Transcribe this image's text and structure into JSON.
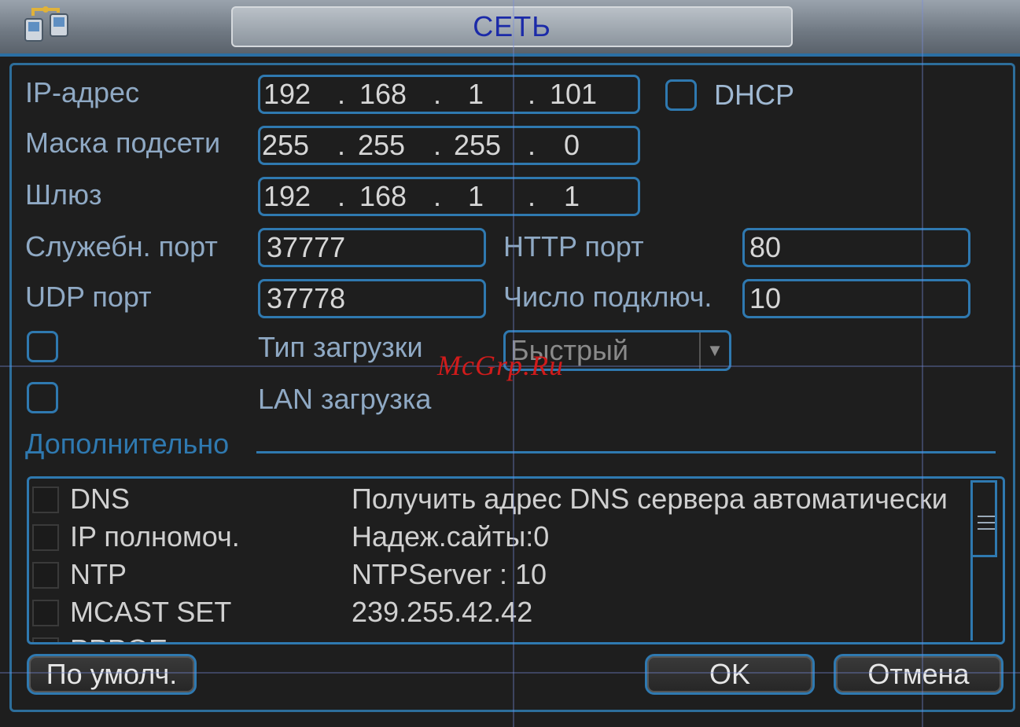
{
  "window": {
    "title": "СЕТЬ"
  },
  "fields": {
    "ip": {
      "label": "IP-адрес",
      "octets": [
        "192",
        "168",
        "1",
        "101"
      ]
    },
    "mask": {
      "label": "Маска подсети",
      "octets": [
        "255",
        "255",
        "255",
        "0"
      ]
    },
    "gateway": {
      "label": "Шлюз",
      "octets": [
        "192",
        "168",
        "1",
        "1"
      ]
    },
    "dhcp": {
      "label": "DHCP",
      "checked": false
    },
    "service_port": {
      "label": "Служебн. порт",
      "value": "37777"
    },
    "http_port": {
      "label": "HTTP порт",
      "value": "80"
    },
    "udp_port": {
      "label": "UDP порт",
      "value": "37778"
    },
    "max_conn": {
      "label": "Число подключ.",
      "value": "10"
    },
    "download_type": {
      "label": "Тип загрузки",
      "value": "Быстрый",
      "enabled": false
    },
    "lan_download": {
      "label": "LAN загрузка",
      "enabled": false
    }
  },
  "advanced": {
    "label": "Дополнительно",
    "rows": [
      {
        "name": "DNS",
        "value": "Получить адрес DNS сервера автоматически"
      },
      {
        "name": "IP полномоч.",
        "value": "Надеж.сайты:0"
      },
      {
        "name": "NTP",
        "value": "NTPServer : 10"
      },
      {
        "name": "MCAST SET",
        "value": "239.255.42.42"
      },
      {
        "name": "PPPOE",
        "value": ""
      }
    ]
  },
  "buttons": {
    "default": "По умолч.",
    "ok": "OK",
    "cancel": "Отмена"
  },
  "watermark": "McGrp.Ru",
  "colors": {
    "accent": "#2f79b0",
    "label": "#8fa9c4",
    "title": "#1b2aa8",
    "watermark": "#d11b1b"
  }
}
